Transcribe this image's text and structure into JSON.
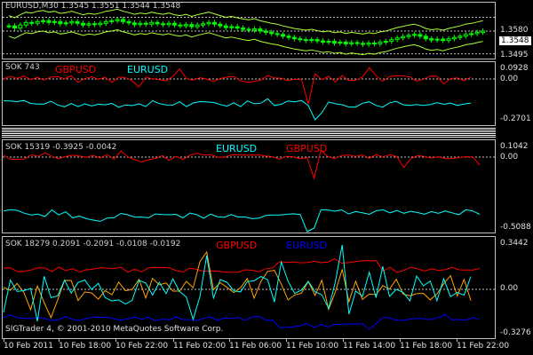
{
  "main_chart": {
    "header": "EURUSD,M30  1.3545 1.3551 1.3544 1.3548",
    "price_tag": "1.3548",
    "axis_labels": [
      "1.3580",
      "1.3495"
    ],
    "candle_closes": [
      1.356,
      1.3555,
      1.3562,
      1.3568,
      1.3566,
      1.357,
      1.3572,
      1.3568,
      1.357,
      1.3565,
      1.3567,
      1.357,
      1.3566,
      1.3562,
      1.3565,
      1.3563,
      1.3566,
      1.357,
      1.3572,
      1.3575,
      1.357,
      1.3567,
      1.3563,
      1.3566,
      1.3564,
      1.3568,
      1.3565,
      1.3563,
      1.3566,
      1.3562,
      1.356,
      1.3563,
      1.3558,
      1.3562,
      1.3565,
      1.3568,
      1.3564,
      1.356,
      1.3556,
      1.3558,
      1.3555,
      1.3552,
      1.355,
      1.3553,
      1.3548,
      1.3545,
      1.3542,
      1.354,
      1.3536,
      1.3533,
      1.353,
      1.3528,
      1.3526,
      1.3528,
      1.3525,
      1.3522,
      1.3524,
      1.352,
      1.3522,
      1.3518,
      1.3521,
      1.3519,
      1.3517,
      1.352,
      1.3518,
      1.3522,
      1.3524,
      1.3528,
      1.3532,
      1.3535,
      1.3538,
      1.354,
      1.3536,
      1.353,
      1.3527,
      1.3529,
      1.3526,
      1.353,
      1.3533,
      1.3536,
      1.354,
      1.3542,
      1.3545,
      1.3548
    ],
    "y_range": [
      1.349,
      1.361
    ],
    "colors": {
      "candle": "#00ff00",
      "band": "#adff2f",
      "grid": "#c0c0c0"
    }
  },
  "panel1": {
    "label": "SOK 743",
    "symbols": [
      {
        "name": "GBPUSD",
        "color": "#ff0000"
      },
      {
        "name": "EURUSD",
        "color": "#00ffff"
      }
    ],
    "axis_labels": [
      "0.0928",
      "0.00",
      "-0.2701"
    ]
  },
  "panel2": {
    "label": "SOK 15319 -0.3925 -0.0042",
    "symbols": [
      {
        "name": "EURUSD",
        "color": "#00ffff"
      },
      {
        "name": "GBPUSD",
        "color": "#ff0000"
      }
    ],
    "axis_labels": [
      "0.1042",
      "0.00",
      "-0.5088"
    ]
  },
  "panel3": {
    "label": "SOK 18279 0.2091 -0.2091 -0.0108 -0.0192",
    "symbols": [
      {
        "name": "GBPUSD",
        "color": "#ff0000"
      },
      {
        "name": "EURUSD",
        "color": "#0000ff"
      }
    ],
    "axis_labels": [
      "0.3442",
      "0.00",
      "-0.3276"
    ]
  },
  "copyright": "SIGTrader 4, © 2001-2010 MetaQuotes Software Corp.",
  "time_axis": [
    "10 Feb 2011",
    "10 Feb 18:00",
    "10 Feb 22:00",
    "11 Feb 02:00",
    "11 Feb 06:00",
    "11 Feb 10:00",
    "11 Feb 14:00",
    "11 Feb 18:00",
    "11 Feb 22:00"
  ]
}
